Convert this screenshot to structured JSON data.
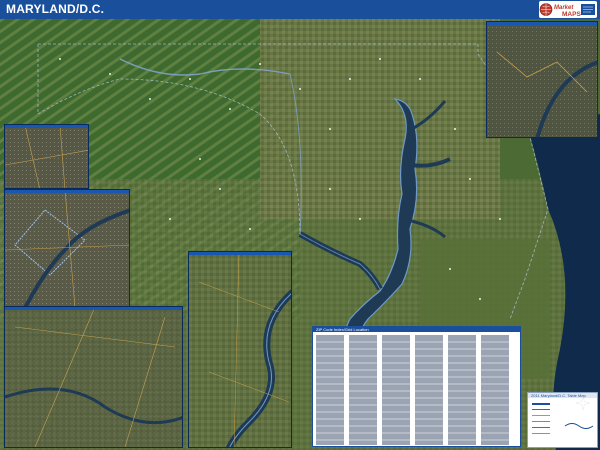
{
  "header": {
    "title": "MARYLAND/D.C.",
    "bar_color": "#1a4f9c"
  },
  "logo": {
    "brand_word": "Market",
    "brand_word2": "MAPS",
    "icon": "globe-icon"
  },
  "map": {
    "type": "satellite-wall-map",
    "region": "Maryland and District of Columbia",
    "land_colors": [
      "#3d6b2e",
      "#5b7a3a",
      "#7a8050",
      "#46613a"
    ],
    "water_color": "#1f3a55",
    "ocean_color": "#0f2a4a",
    "insets": [
      "northeast-inset",
      "northwest-inset",
      "dc-inset",
      "southwest-inset",
      "central-inset"
    ]
  },
  "zip_panel": {
    "heading": "ZIP Code Index/Grid Location"
  },
  "legend_panel": {
    "heading": "2011 Maryland/D.C. Table Map"
  },
  "compass": {
    "icon": "compass-rose-icon"
  }
}
